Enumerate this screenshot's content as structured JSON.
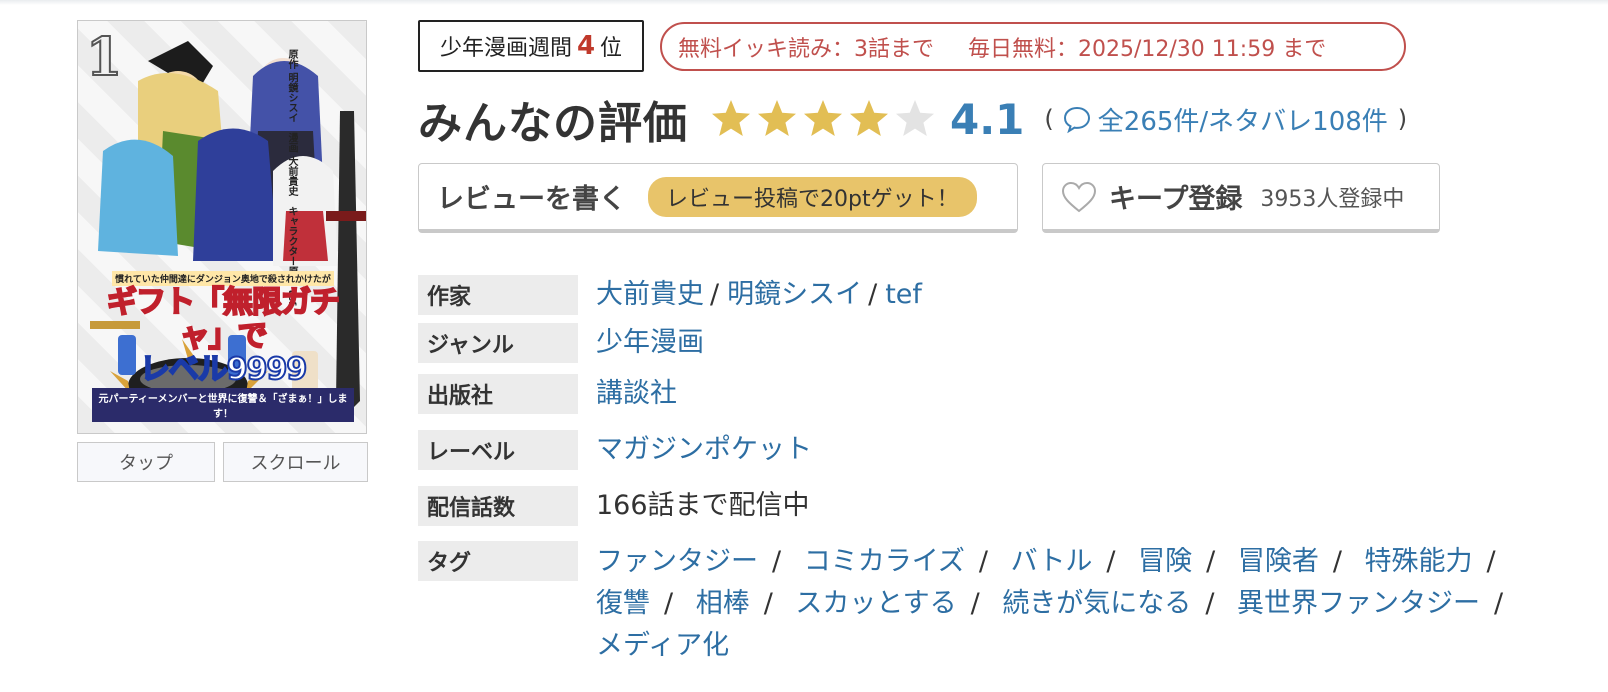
{
  "cover": {
    "volume": "1",
    "title_pre": "慣れていた仲間達にダンジョン奥地で殺されかけたが",
    "title_line1": "ギフト「無限ガチャ」で",
    "title_line2": "レベル9999",
    "title_sub": "元パーティーメンバーと世界に復讐＆「ざまぁ！」します！",
    "credits": "原作 明鏡シスイ　漫画 大前貴史　キャラクター原案 tef"
  },
  "view_buttons": {
    "tap": "タップ",
    "scroll": "スクロール"
  },
  "rank": {
    "prefix": "少年漫画週間",
    "number": "4",
    "suffix": "位"
  },
  "free": {
    "left": "無料イッキ読み：3話まで",
    "right": "毎日無料：2025/12/30 11:59 まで"
  },
  "rating": {
    "title": "みんなの評価",
    "value": "4.1",
    "filled_stars": 4,
    "total_stars": 5,
    "open_paren": "(",
    "close_paren": ")",
    "reviews": "全265件/ネタバレ108件"
  },
  "colors": {
    "star_filled": "#e2be54",
    "star_empty": "#e3e3e3",
    "link": "#2d6ea3",
    "accent_red": "#c0504d",
    "pill": "#e8c46a"
  },
  "actions": {
    "write_review": "レビューを書く",
    "write_review_badge": "レビュー投稿で20ptゲット！",
    "keep": "キープ登録",
    "keep_count": "3953人登録中"
  },
  "info": {
    "author_label": "作家",
    "authors": [
      "大前貴史",
      "明鏡シスイ",
      "tef"
    ],
    "author_sep": "/",
    "genre_label": "ジャンル",
    "genre": "少年漫画",
    "publisher_label": "出版社",
    "publisher": "講談社",
    "label_label": "レーベル",
    "label": "マガジンポケット",
    "episodes_label": "配信話数",
    "episodes": "166話まで配信中",
    "tags_label": "タグ",
    "tag_sep": "/",
    "tags": [
      "ファンタジー",
      "コミカライズ",
      "バトル",
      "冒険",
      "冒険者",
      "特殊能力",
      "復讐",
      "相棒",
      "スカッとする",
      "続きが気になる",
      "異世界ファンタジー",
      "メディア化"
    ]
  }
}
